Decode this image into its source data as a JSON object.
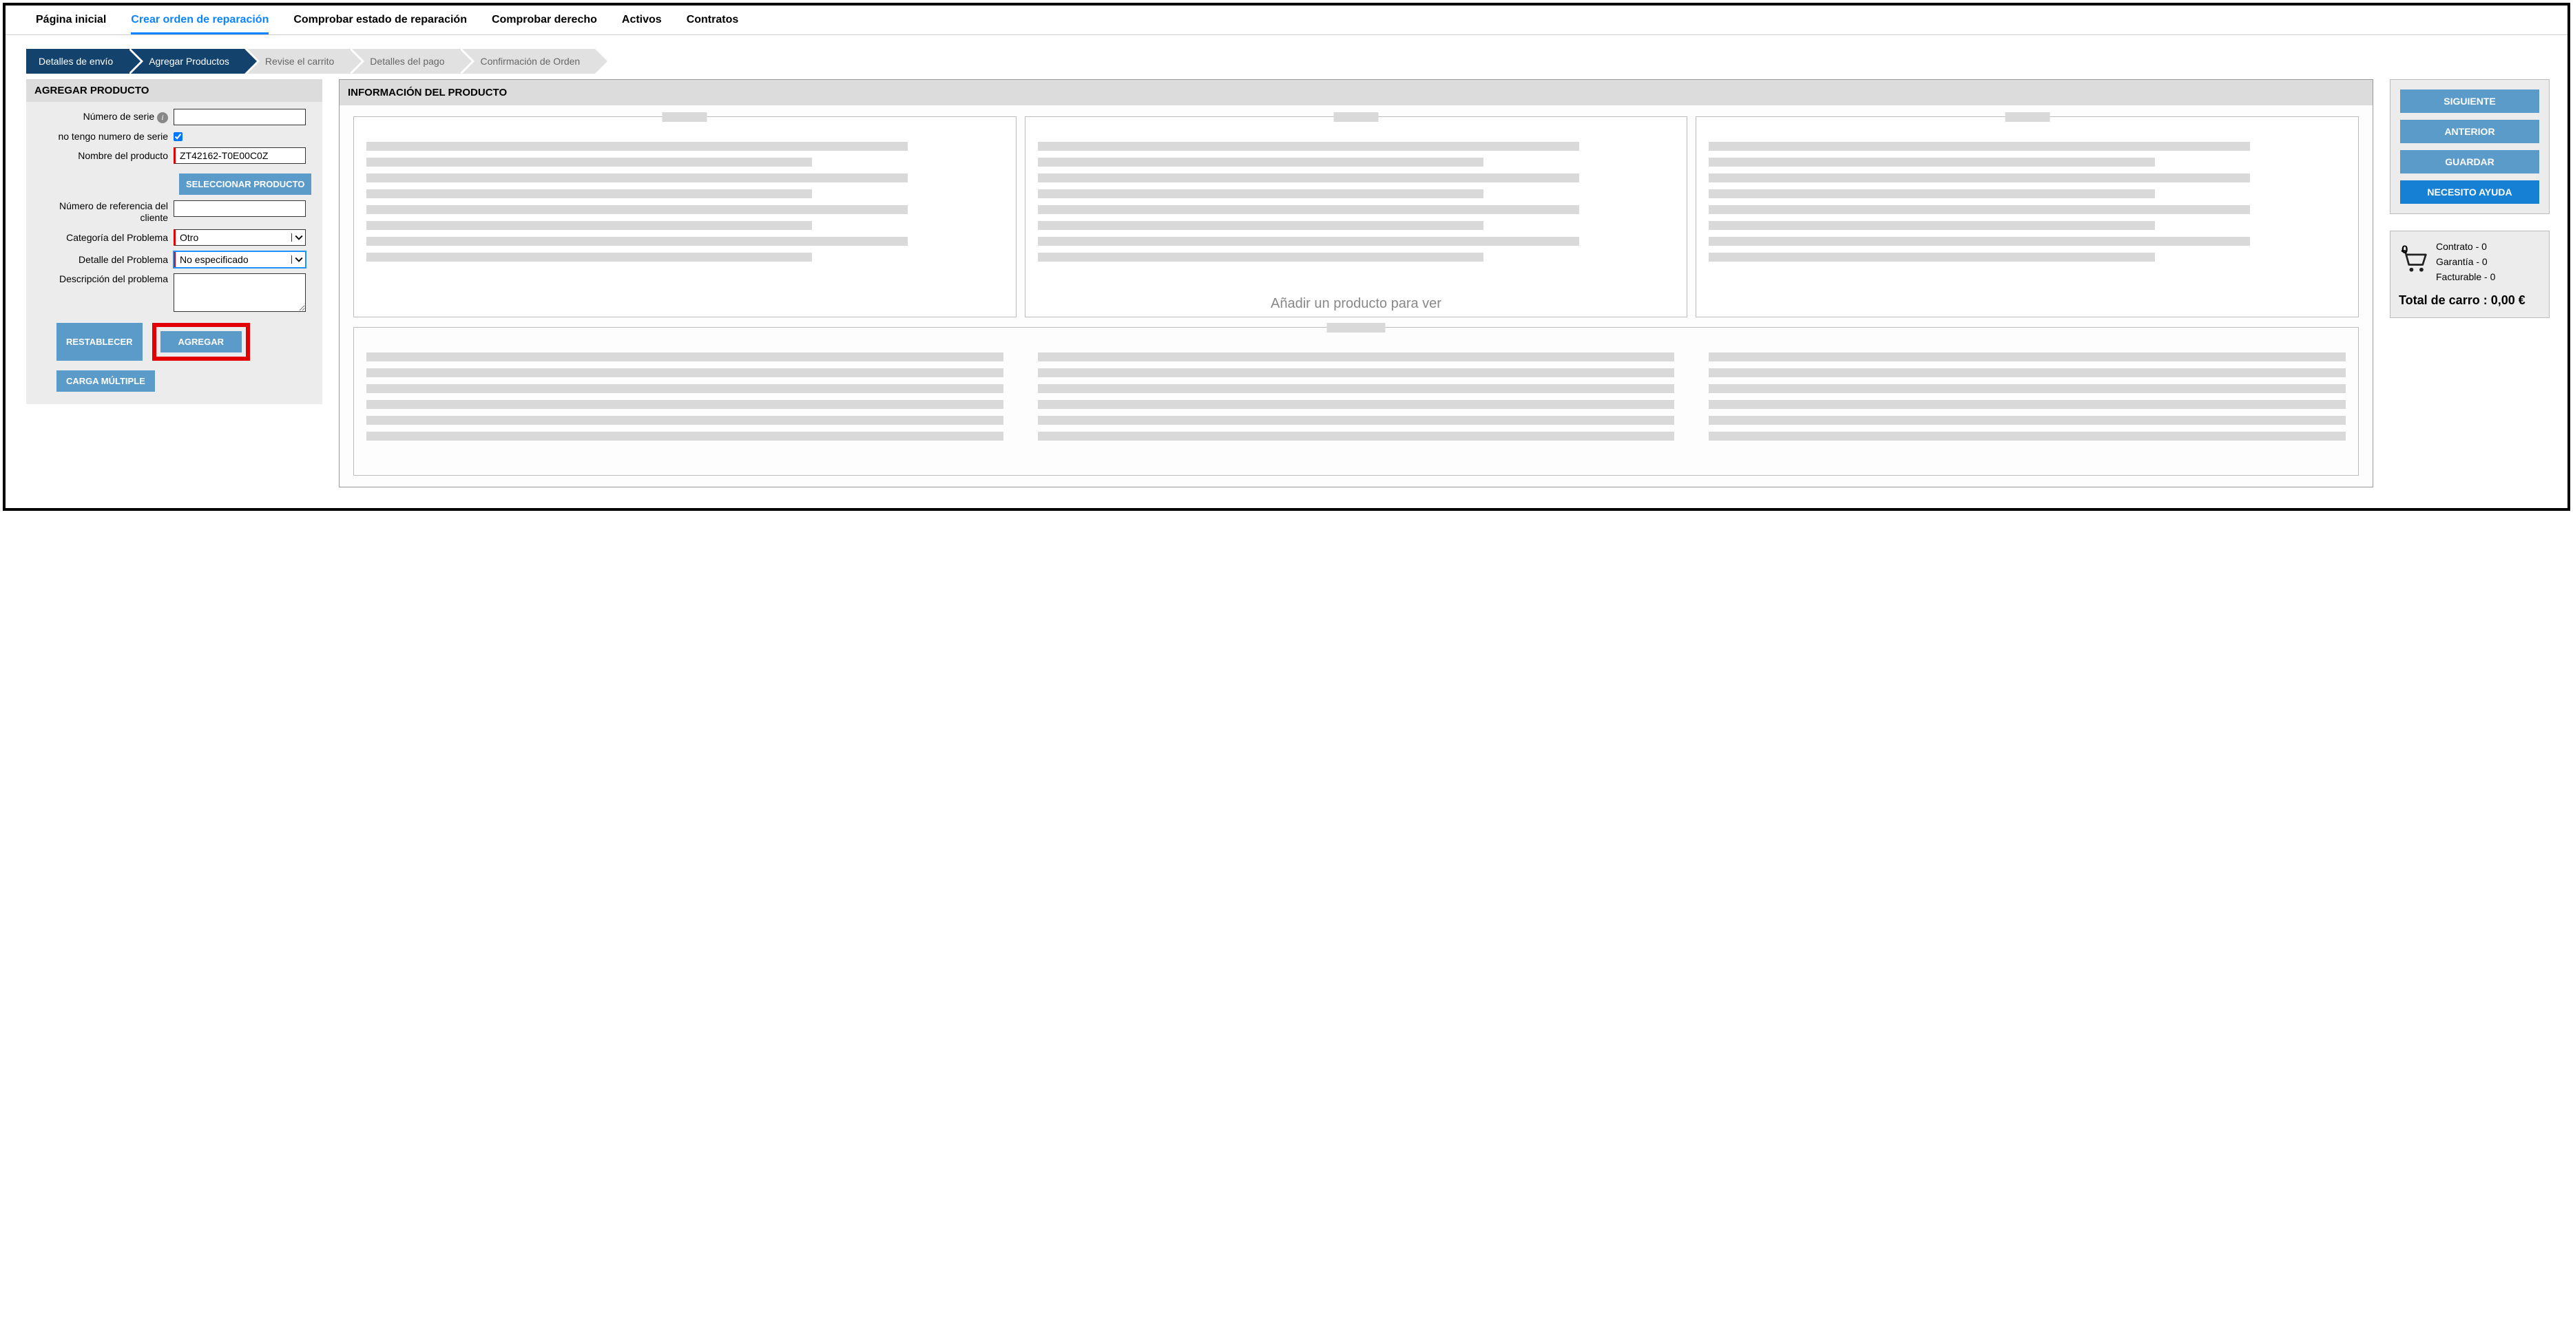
{
  "nav": {
    "tab_home": "Página inicial",
    "tab_create": "Crear orden de reparación",
    "tab_status": "Comprobar estado de reparación",
    "tab_entitlement": "Comprobar derecho",
    "tab_assets": "Activos",
    "tab_contracts": "Contratos"
  },
  "wizard": {
    "step1": "Detalles de envío",
    "step2": "Agregar Productos",
    "step3": "Revise el carrito",
    "step4": "Detalles del pago",
    "step5": "Confirmación de Orden"
  },
  "left": {
    "header": "AGREGAR PRODUCTO",
    "serial_label": "Número de serie",
    "serial_value": "",
    "noserial_label": "no tengo numero de serie",
    "noserial_checked": true,
    "product_label": "Nombre del producto",
    "product_value": "ZT42162-T0E00C0Z",
    "select_product_btn": "SELECCIONAR PRODUCTO",
    "custref_label": "Número de referencia del cliente",
    "custref_value": "",
    "problem_cat_label": "Categoría del Problema",
    "problem_cat_value": "Otro",
    "problem_detail_label": "Detalle del Problema",
    "problem_detail_value": "No especificado",
    "problem_desc_label": "Descripción del problema",
    "problem_desc_value": "",
    "reset_btn": "RESTABLECER",
    "add_btn": "AGREGAR",
    "bulk_btn": "CARGA MÚLTIPLE"
  },
  "center": {
    "header": "INFORMACIÓN DEL PRODUCTO",
    "placeholder_text": "Añadir un producto para ver"
  },
  "right": {
    "next_btn": "SIGUIENTE",
    "prev_btn": "ANTERIOR",
    "save_btn": "GUARDAR",
    "help_btn": "NECESITO AYUDA",
    "cart_count": "0",
    "cart_line1": "Contrato - 0",
    "cart_line2": "Garantía - 0",
    "cart_line3": "Facturable - 0",
    "cart_total": "Total de carro : 0,00 €"
  }
}
